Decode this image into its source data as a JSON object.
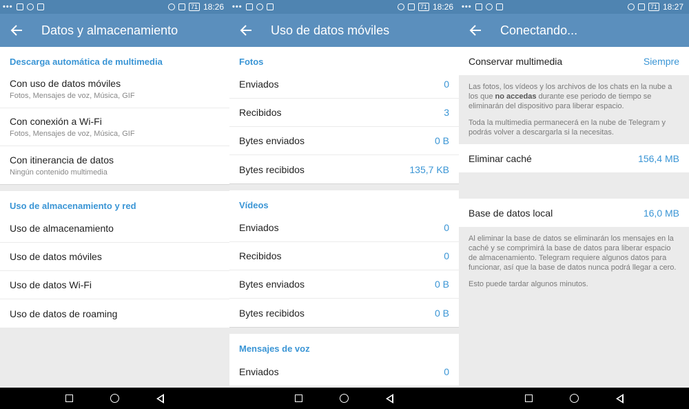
{
  "colors": {
    "appbar": "#5b8fbd",
    "statusbar": "#4f84b1",
    "accent": "#3a95d5"
  },
  "panel1": {
    "status": {
      "time": "18:26",
      "battery": "71"
    },
    "title": "Datos y almacenamiento",
    "sections": [
      {
        "title": "Descarga automática de multimedia",
        "items": [
          {
            "label": "Con uso de datos móviles",
            "sub": "Fotos, Mensajes de voz, Música, GIF"
          },
          {
            "label": "Con conexión a Wi-Fi",
            "sub": "Fotos, Mensajes de voz, Música, GIF"
          },
          {
            "label": "Con itinerancia de datos",
            "sub": "Ningún contenido multimedia"
          }
        ]
      },
      {
        "title": "Uso de almacenamiento y red",
        "items": [
          {
            "label": "Uso de almacenamiento"
          },
          {
            "label": "Uso de datos móviles"
          },
          {
            "label": "Uso de datos Wi-Fi"
          },
          {
            "label": "Uso de datos de roaming"
          }
        ]
      }
    ]
  },
  "panel2": {
    "status": {
      "time": "18:26",
      "battery": "71"
    },
    "title": "Uso de datos móviles",
    "sections": [
      {
        "title": "Fotos",
        "items": [
          {
            "label": "Enviados",
            "value": "0"
          },
          {
            "label": "Recibidos",
            "value": "3"
          },
          {
            "label": "Bytes enviados",
            "value": "0 B"
          },
          {
            "label": "Bytes recibidos",
            "value": "135,7 KB"
          }
        ]
      },
      {
        "title": "Vídeos",
        "items": [
          {
            "label": "Enviados",
            "value": "0"
          },
          {
            "label": "Recibidos",
            "value": "0"
          },
          {
            "label": "Bytes enviados",
            "value": "0 B"
          },
          {
            "label": "Bytes recibidos",
            "value": "0 B"
          }
        ]
      },
      {
        "title": "Mensajes de voz",
        "items": [
          {
            "label": "Enviados",
            "value": "0"
          }
        ]
      }
    ]
  },
  "panel3": {
    "status": {
      "time": "18:27",
      "battery": "71"
    },
    "title": "Conectando...",
    "keep_media": {
      "label": "Conservar multimedia",
      "value": "Siempre"
    },
    "info1_pre": "Las fotos, los vídeos y los archivos de los chats en la nube a los que ",
    "info1_bold": "no accedas",
    "info1_post": " durante ese periodo de tiempo se eliminarán del dispositivo para liberar espacio.",
    "info2": "Toda la multimedia permanecerá en la nube de Telegram y podrás volver a descargarla si la necesitas.",
    "clear_cache": {
      "label": "Eliminar caché",
      "value": "156,4 MB"
    },
    "local_db": {
      "label": "Base de datos local",
      "value": "16,0 MB"
    },
    "info3": "Al eliminar la base de datos se eliminarán los mensajes en la caché y se comprimirá la base de datos para liberar espacio de almacenamiento. Telegram requiere algunos datos para funcionar, así que la base de datos nunca podrá llegar a cero.",
    "info4": "Esto puede tardar algunos minutos."
  }
}
